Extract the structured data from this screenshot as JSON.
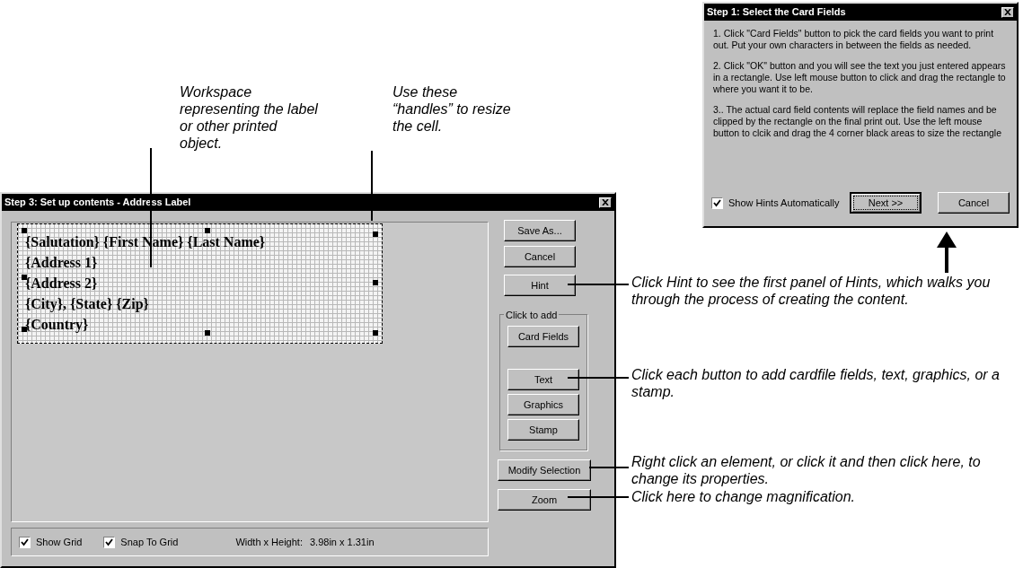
{
  "callouts": [
    {
      "kind": "workspace",
      "text": "Workspace representing the label or other printed object."
    },
    {
      "kind": "handles",
      "text": "Use these “handles” to resize the cell."
    },
    {
      "kind": "hint",
      "text": "Click Hint to see the first panel of Hints, which walks you through the process of creating the content."
    },
    {
      "kind": "add",
      "text": "Click each button to add cardfile fields, text, graphics, or a stamp."
    },
    {
      "kind": "modify",
      "text": "Right click an element, or click it and then click here, to change its properties."
    },
    {
      "kind": "zoom",
      "text": "Click here to change magnification."
    }
  ],
  "main_window": {
    "title": "Step 3: Set up contents - Address Label",
    "fields": [
      "{Salutation} {First Name} {Last Name}",
      "{Address 1}",
      "{Address 2}",
      "{City},  {State}  {Zip}",
      "{Country}"
    ],
    "top_buttons": [
      {
        "label": "Save As..."
      },
      {
        "label": "Cancel"
      },
      {
        "label": "Hint"
      }
    ],
    "group": {
      "legend": "Click to add",
      "buttons": [
        {
          "label": "Card Fields"
        },
        {
          "label": "Text"
        },
        {
          "label": "Graphics"
        },
        {
          "label": "Stamp"
        }
      ]
    },
    "bottom_buttons": [
      {
        "label": "Modify Selection"
      },
      {
        "label": "Zoom"
      }
    ],
    "checkboxes": [
      {
        "label": "Show Grid",
        "checked": true
      },
      {
        "label": "Snap To Grid",
        "checked": true
      }
    ],
    "size_label": "Width x Height:",
    "size_value": "3.98in x 1.31in"
  },
  "hint_dialog": {
    "title": "Step 1: Select the Card Fields",
    "paragraphs": [
      "1. Click \"Card Fields\" button to pick the card fields you want to print out. Put your own characters in between the fields as needed.",
      "2. Click \"OK\" button and you will see the text you just entered appears in a rectangle. Use left mouse button to click and drag the rectangle to where you want it to be.",
      "3.. The actual card field contents will replace the field names and be clipped by the rectangle on the final print out. Use the left mouse button to clcik and drag the 4 corner black areas to size the rectangle"
    ],
    "checkbox": {
      "label": "Show Hints Automatically",
      "checked": true
    },
    "buttons": [
      {
        "label": "Next >>",
        "focused": true
      },
      {
        "label": "Cancel",
        "focused": false
      }
    ]
  }
}
